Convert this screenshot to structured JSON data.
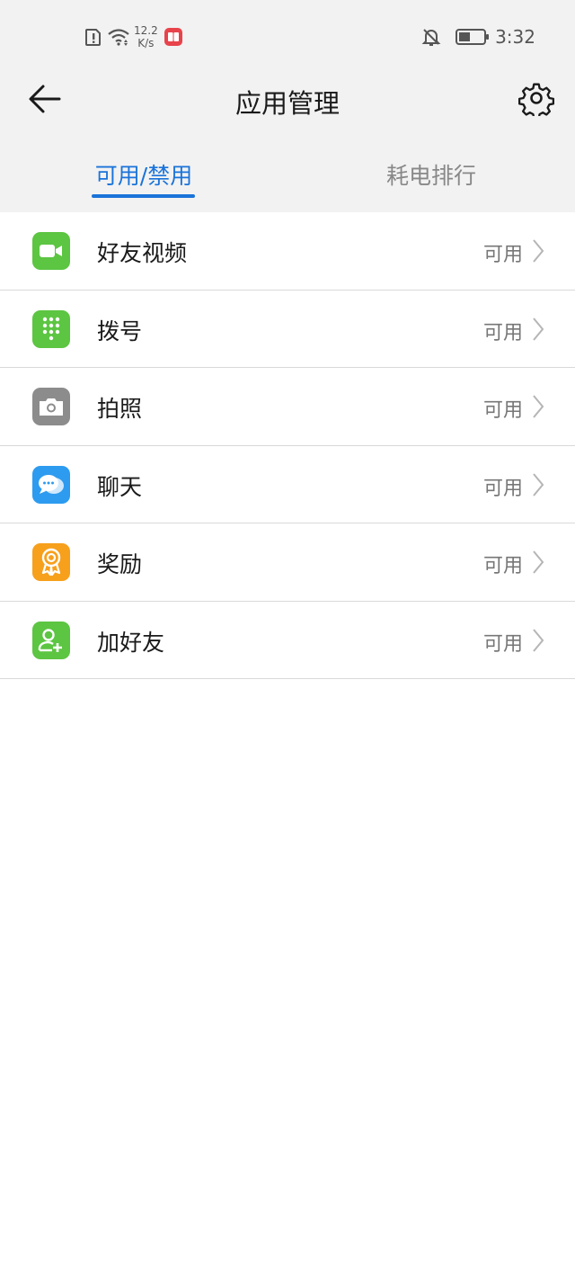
{
  "status_bar": {
    "net_speed_value": "12.2",
    "net_speed_unit": "K/s",
    "time": "3:32",
    "icons": [
      "sim-alert-icon",
      "wifi-icon",
      "app-notification-icon",
      "bell-off-icon",
      "battery-icon"
    ]
  },
  "header": {
    "title": "应用管理"
  },
  "tabs": [
    {
      "label": "可用/禁用",
      "active": true
    },
    {
      "label": "耗电排行",
      "active": false
    }
  ],
  "apps": [
    {
      "name": "好友视频",
      "status": "可用",
      "icon": "video-icon",
      "color": "#5cc542"
    },
    {
      "name": "拨号",
      "status": "可用",
      "icon": "dialpad-icon",
      "color": "#5cc542"
    },
    {
      "name": "拍照",
      "status": "可用",
      "icon": "camera-icon",
      "color": "#8c8c8c"
    },
    {
      "name": "聊天",
      "status": "可用",
      "icon": "chat-icon",
      "color": "#2d9bef"
    },
    {
      "name": "奖励",
      "status": "可用",
      "icon": "award-icon",
      "color": "#f7a01c"
    },
    {
      "name": "加好友",
      "status": "可用",
      "icon": "add-friend-icon",
      "color": "#5cc542"
    }
  ],
  "colors": {
    "accent": "#1a73d9",
    "background_header": "#f2f2f2"
  }
}
